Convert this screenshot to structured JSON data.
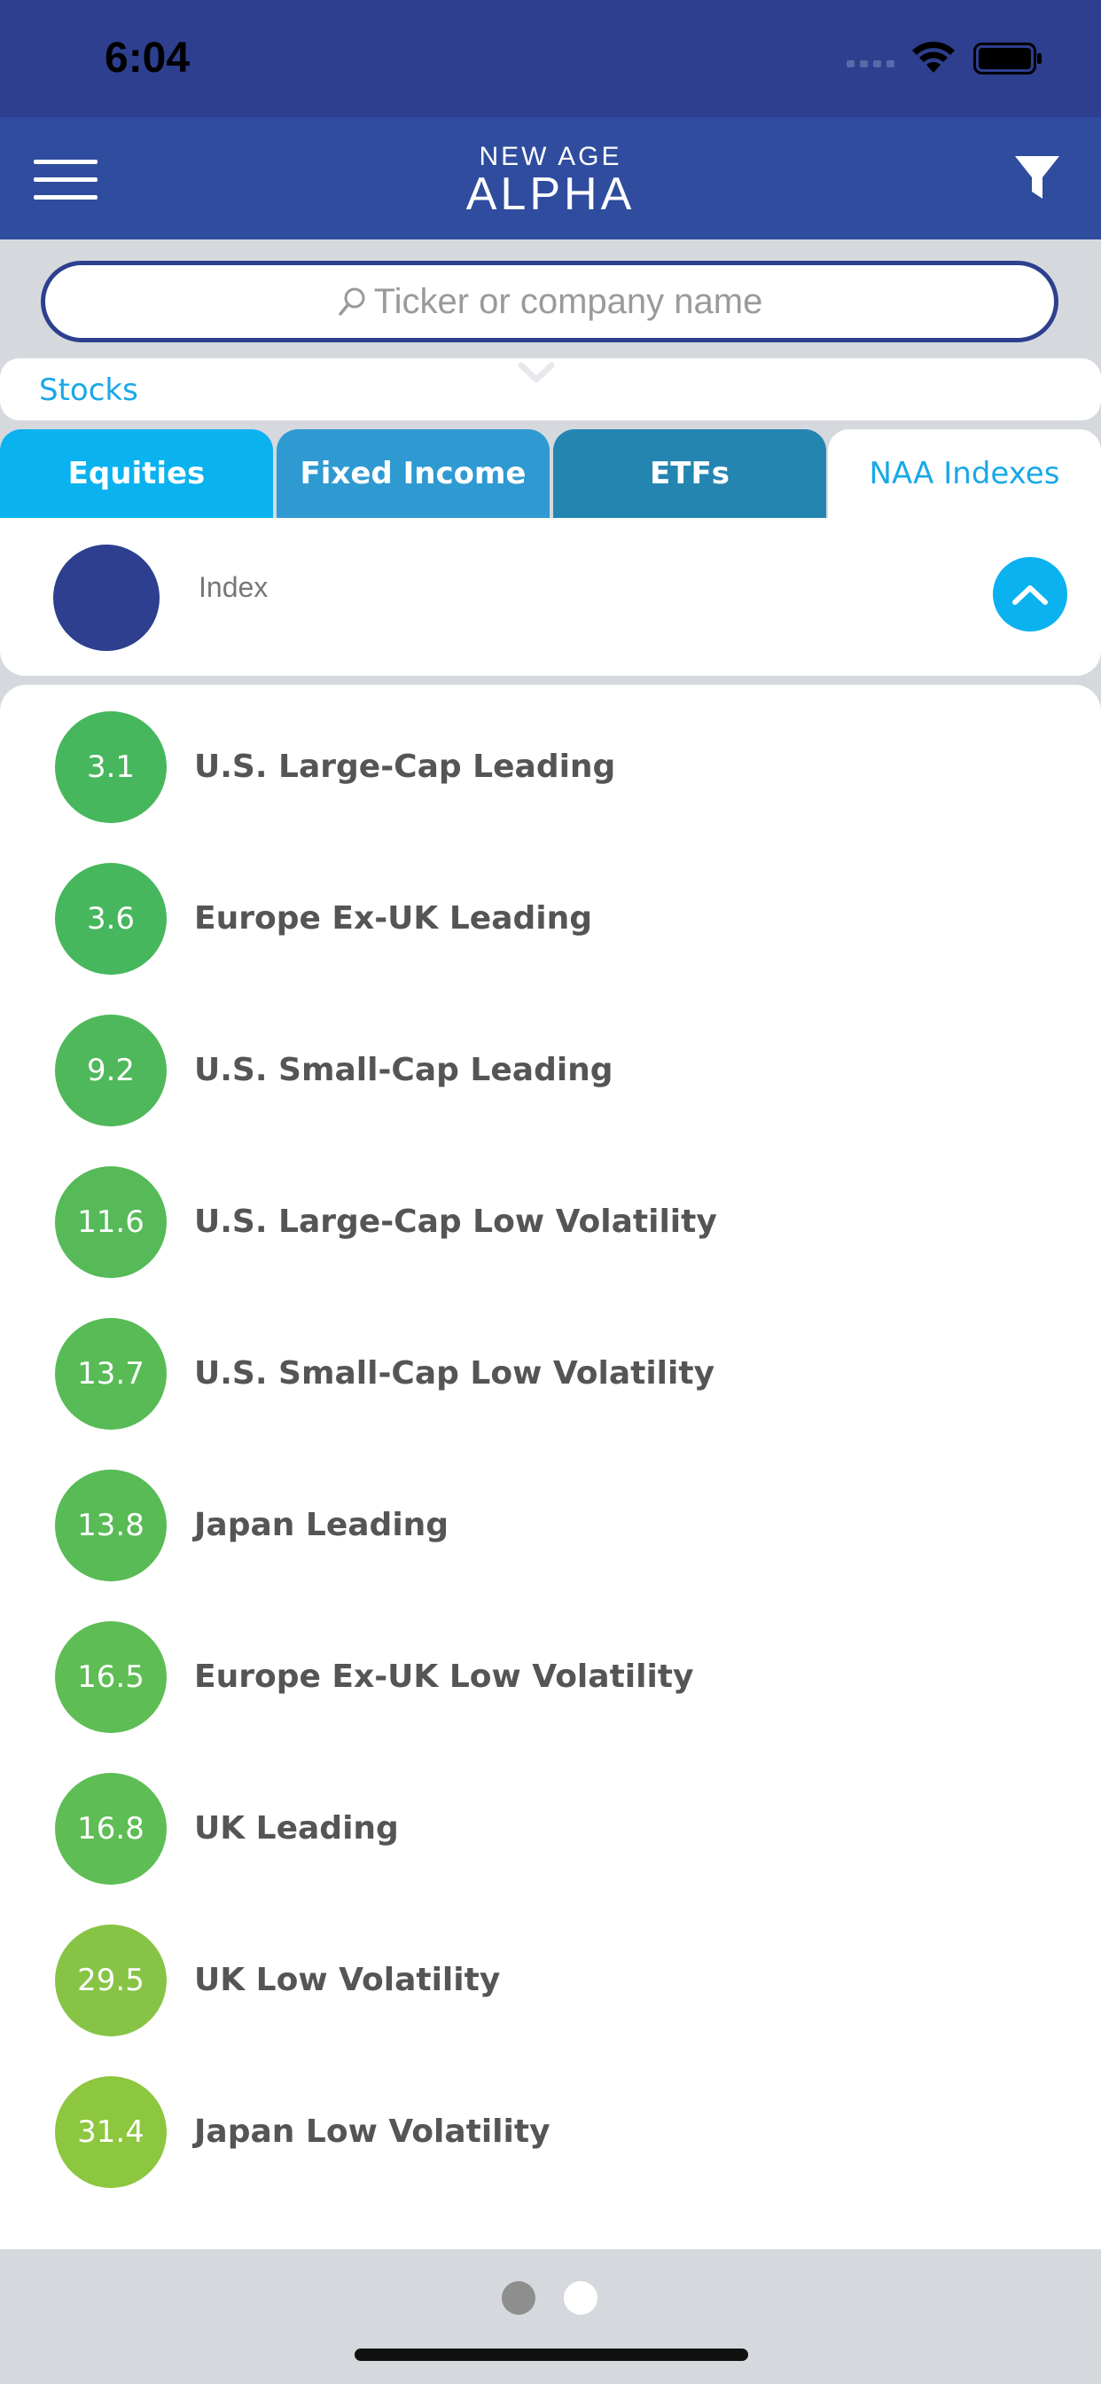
{
  "status_bar": {
    "time": "6:04"
  },
  "header": {
    "logo_line1": "NEW AGE",
    "logo_line2": "ALPHA",
    "menu_icon": "hamburger-menu-icon",
    "filter_icon": "filter-funnel-icon"
  },
  "search": {
    "placeholder": "Ticker or company name"
  },
  "category": {
    "label": "Stocks"
  },
  "tabs": [
    {
      "label": "Equities"
    },
    {
      "label": "Fixed Income"
    },
    {
      "label": "ETFs"
    },
    {
      "label": "NAA Indexes",
      "active": true
    }
  ],
  "index_header": {
    "label": "Index"
  },
  "indexes": [
    {
      "score": "3.1",
      "name": "U.S. Large-Cap Leading",
      "color": "#46b75c"
    },
    {
      "score": "3.6",
      "name": "Europe Ex-UK Leading",
      "color": "#46b75c"
    },
    {
      "score": "9.2",
      "name": "U.S. Small-Cap Leading",
      "color": "#4fb85a"
    },
    {
      "score": "11.6",
      "name": "U.S. Large-Cap Low Volatility",
      "color": "#55ba57"
    },
    {
      "score": "13.7",
      "name": "U.S. Small-Cap Low Volatility",
      "color": "#58bb56"
    },
    {
      "score": "13.8",
      "name": "Japan Leading",
      "color": "#58bb56"
    },
    {
      "score": "16.5",
      "name": "Europe Ex-UK Low Volatility",
      "color": "#5ebd54"
    },
    {
      "score": "16.8",
      "name": "UK Leading",
      "color": "#5ebd54"
    },
    {
      "score": "29.5",
      "name": "UK Low Volatility",
      "color": "#87c446"
    },
    {
      "score": "31.4",
      "name": "Japan Low Volatility",
      "color": "#8dc63f"
    }
  ],
  "colors": {
    "navy": "#2d3f8e",
    "header_blue": "#2f4c9e",
    "accent_cyan": "#0ab2f0"
  }
}
